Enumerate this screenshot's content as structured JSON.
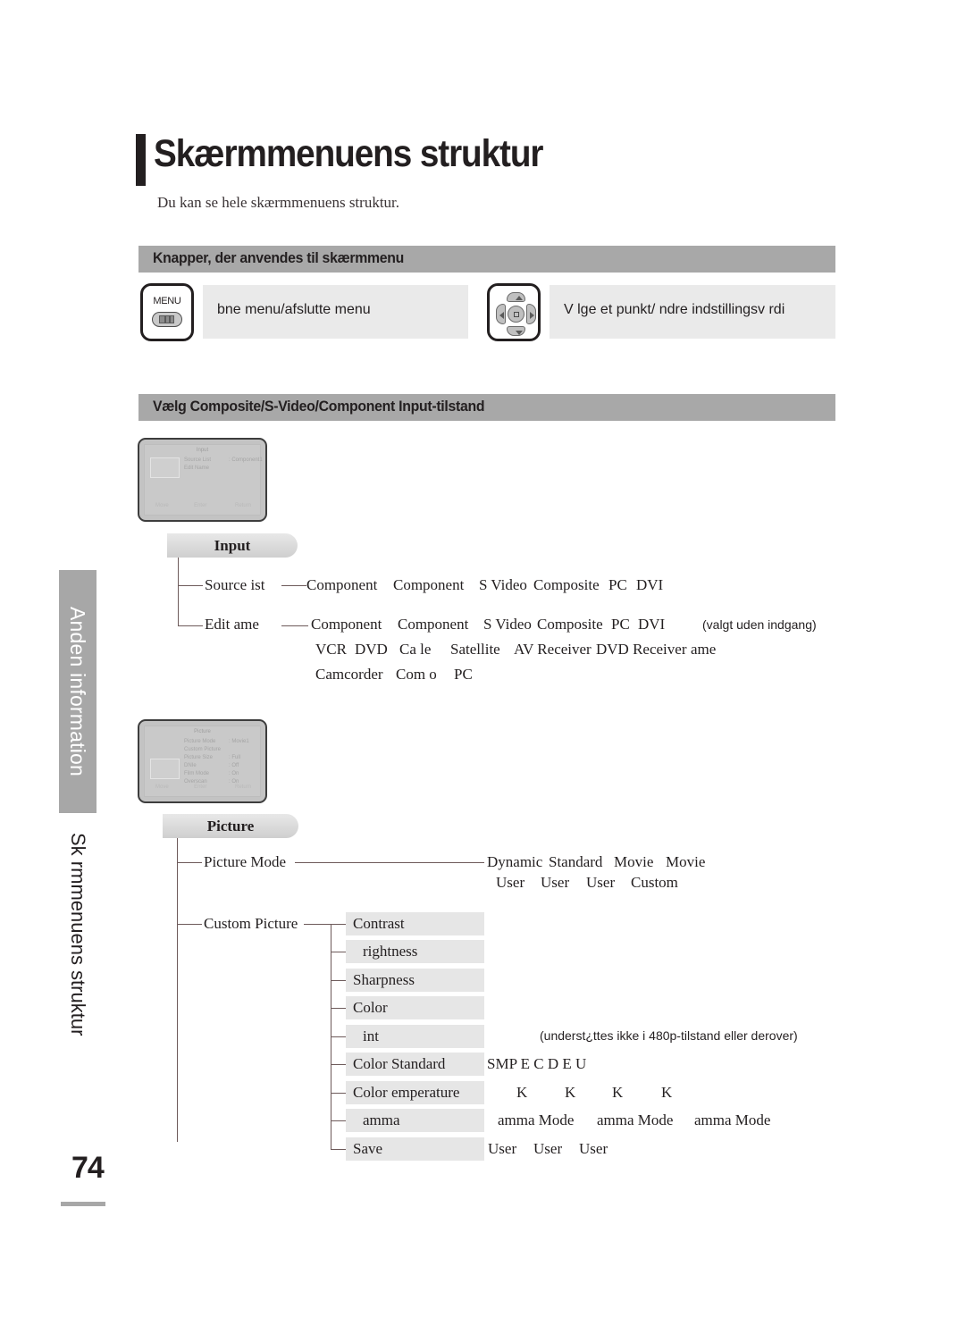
{
  "page": {
    "number": "74",
    "title": "Skærmmenuens struktur",
    "subtitle": "Du kan se hele skærmmenuens struktur."
  },
  "sidebar": {
    "tab_label": "Anden information",
    "section_label": "Sk rmmenuens struktur"
  },
  "sections": {
    "buttons_header": "Knapper, der anvendes til skærmmenu",
    "input_header": "Vælg Composite/S-Video/Component Input-tilstand"
  },
  "legend": {
    "menu_icon_label": "MENU",
    "menu_description": "bne menu/afslutte menu",
    "dpad_description": "V lge et punkt/ ndre indstillingsv rdi"
  },
  "osd_input": {
    "title": "Input",
    "rows": [
      {
        "key": "Source List",
        "value": ": Component1"
      },
      {
        "key": "Edit Name",
        "value": ""
      }
    ],
    "footer": {
      "move": "Move",
      "enter": "Enter",
      "return": "Return"
    }
  },
  "osd_picture": {
    "title": "Picture",
    "rows": [
      {
        "key": "Picture Mode",
        "value": ": Movie1"
      },
      {
        "key": "Custom Picture",
        "value": ""
      },
      {
        "key": "Picture Size",
        "value": ": Full"
      },
      {
        "key": "DNIe",
        "value": ": Off"
      },
      {
        "key": "Film Mode",
        "value": ": On"
      },
      {
        "key": "Overscan",
        "value": ": On"
      }
    ],
    "footer": {
      "move": "Move",
      "enter": "Enter",
      "return": "Return"
    }
  },
  "input_tree": {
    "node_label": "Input",
    "source_list": {
      "label": "Source ist",
      "values": [
        "Component",
        "Component",
        "S Video",
        "Composite",
        "PC",
        "DVI"
      ]
    },
    "edit_name": {
      "label": "Edit ame",
      "values_row1": [
        "Component",
        "Component",
        "S Video",
        "Composite",
        "PC",
        "DVI"
      ],
      "note": "(valgt uden indgang)",
      "values_row2": [
        "VCR",
        "DVD",
        "Ca le",
        "Satellite",
        "AV Receiver",
        "DVD Receiver",
        "ame"
      ],
      "values_row3": [
        "Camcorder",
        "Com o",
        "PC"
      ]
    }
  },
  "picture_tree": {
    "node_label": "Picture",
    "picture_mode": {
      "label": "Picture Mode",
      "values_row1": [
        "Dynamic",
        "Standard",
        "Movie",
        "Movie"
      ],
      "values_row2": [
        "User",
        "User",
        "User",
        "Custom"
      ]
    },
    "custom_picture": {
      "label": "Custom Picture",
      "items": [
        {
          "label": "Contrast",
          "indent": false,
          "values": ""
        },
        {
          "label": "rightness",
          "indent": true,
          "values": ""
        },
        {
          "label": "Sharpness",
          "indent": false,
          "values": ""
        },
        {
          "label": "Color",
          "indent": false,
          "values": ""
        },
        {
          "label": "int",
          "indent": true,
          "values": ""
        },
        {
          "label": "Color Standard",
          "indent": false,
          "values": ""
        },
        {
          "label": "Color  emperature",
          "indent": false,
          "values": ""
        },
        {
          "label": "amma",
          "indent": true,
          "values": ""
        },
        {
          "label": "Save",
          "indent": false,
          "values": ""
        }
      ],
      "tint_note": "(underst¿ttes ikke i 480p-tilstand eller derover)",
      "color_standard_values": "SMP  E C    D E  U",
      "color_temperature_values": [
        "K",
        "K",
        "K",
        "K"
      ],
      "gamma_values": [
        "amma Mode",
        "amma Mode",
        "amma Mode"
      ],
      "save_values": [
        "User",
        "User",
        "User"
      ]
    }
  }
}
